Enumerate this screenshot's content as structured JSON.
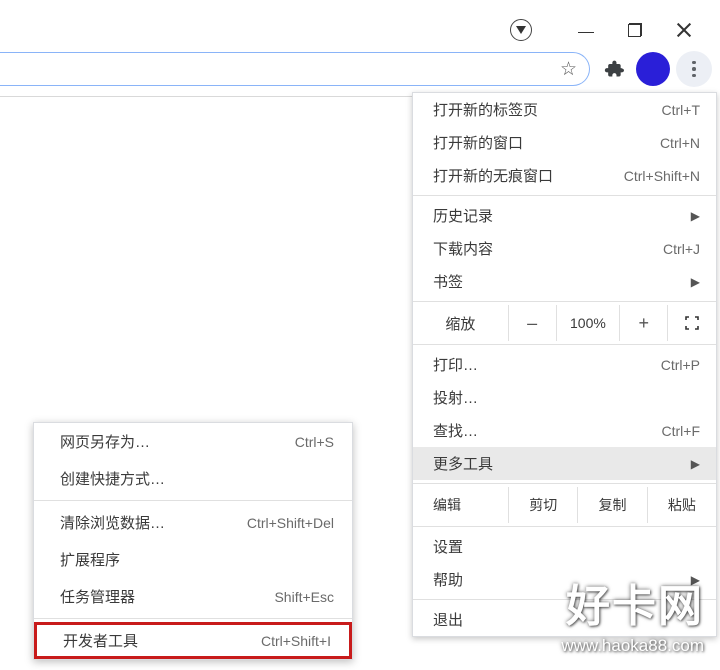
{
  "window": {
    "minimize": "minimize",
    "maximize": "restore",
    "close": "close"
  },
  "toolbar": {
    "star": "☆"
  },
  "menu": {
    "new_tab": {
      "label": "打开新的标签页",
      "shortcut": "Ctrl+T"
    },
    "new_window": {
      "label": "打开新的窗口",
      "shortcut": "Ctrl+N"
    },
    "new_incognito": {
      "label": "打开新的无痕窗口",
      "shortcut": "Ctrl+Shift+N"
    },
    "history": {
      "label": "历史记录"
    },
    "downloads": {
      "label": "下载内容",
      "shortcut": "Ctrl+J"
    },
    "bookmarks": {
      "label": "书签"
    },
    "zoom": {
      "label": "缩放",
      "value": "100%",
      "minus": "–",
      "plus": "+"
    },
    "print": {
      "label": "打印…",
      "shortcut": "Ctrl+P"
    },
    "cast": {
      "label": "投射…"
    },
    "find": {
      "label": "查找…",
      "shortcut": "Ctrl+F"
    },
    "more_tools": {
      "label": "更多工具"
    },
    "edit": {
      "label": "编辑",
      "cut": "剪切",
      "copy": "复制",
      "paste": "粘贴"
    },
    "settings": {
      "label": "设置"
    },
    "help": {
      "label": "帮助"
    },
    "exit": {
      "label": "退出"
    }
  },
  "submenu": {
    "save_as": {
      "label": "网页另存为…",
      "shortcut": "Ctrl+S"
    },
    "create_shortcut": {
      "label": "创建快捷方式…"
    },
    "clear_data": {
      "label": "清除浏览数据…",
      "shortcut": "Ctrl+Shift+Del"
    },
    "extensions": {
      "label": "扩展程序"
    },
    "task_manager": {
      "label": "任务管理器",
      "shortcut": "Shift+Esc"
    },
    "dev_tools": {
      "label": "开发者工具",
      "shortcut": "Ctrl+Shift+I"
    }
  },
  "watermark": {
    "title": "好卡网",
    "url": "www.haoka88.com"
  }
}
